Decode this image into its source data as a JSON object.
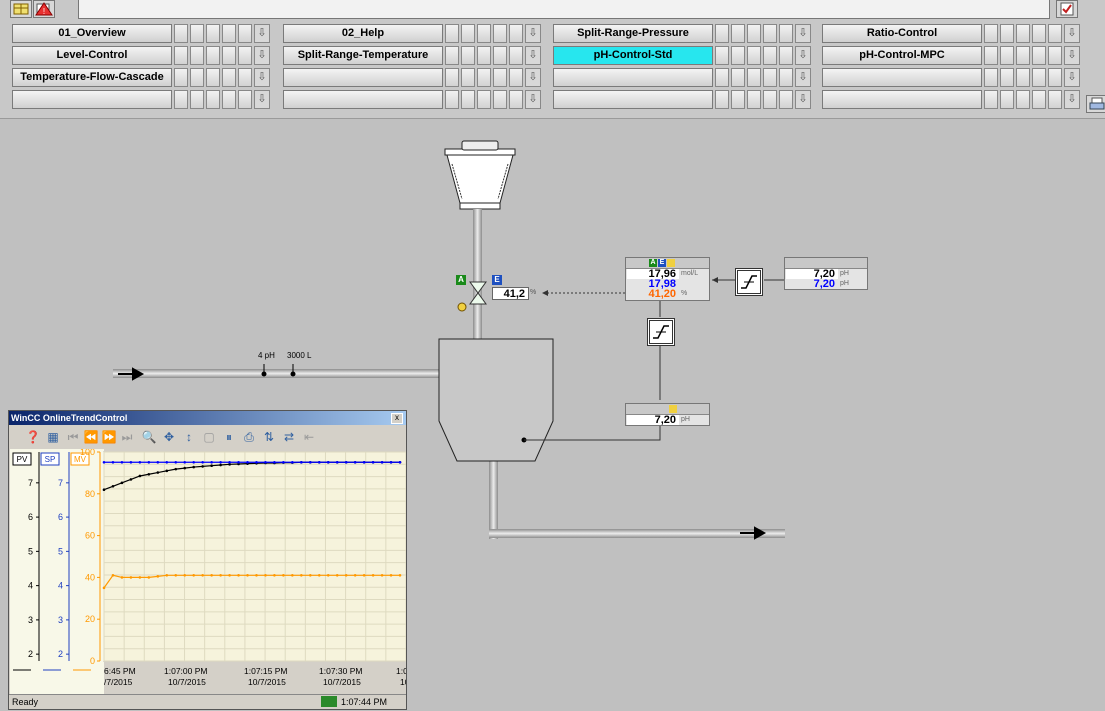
{
  "nav": {
    "rows": [
      [
        "01_Overview",
        "02_Help",
        "Split-Range-Pressure",
        "Ratio-Control"
      ],
      [
        "Level-Control",
        "Split-Range-Temperature",
        "pH-Control-Std",
        "pH-Control-MPC"
      ],
      [
        "Temperature-Flow-Cascade",
        "",
        "",
        ""
      ],
      [
        "",
        "",
        "",
        ""
      ]
    ],
    "active": "pH-Control-Std",
    "arrow_glyph": "⇩"
  },
  "process": {
    "valve": {
      "auto_badge": "A",
      "ext_badge": "E",
      "output": "41,2",
      "output_unit": "%"
    },
    "inlet_tags": {
      "ph": "4 pH",
      "volume": "3000 L"
    },
    "controller": {
      "badges": [
        "A",
        "E"
      ],
      "pv": "17,96",
      "pv_unit": "mol/L",
      "sp": "17,98",
      "out": "41,20",
      "out_unit": "%"
    },
    "ph_setpoint": {
      "value": "7,20",
      "unit": "pH",
      "value2": "7,20",
      "unit2": "pH"
    },
    "ph_measure": {
      "value": "7,20",
      "unit": "pH"
    },
    "colors": {
      "pv": "#000000",
      "sp": "#0000ff",
      "out": "#ff6600",
      "active_nav": "#27e6ee"
    }
  },
  "trend": {
    "title": "WinCC OnlineTrendControl",
    "close_glyph": "x",
    "axis_buttons": [
      "PV",
      "SP",
      "MV"
    ],
    "pv_ticks": [
      "7",
      "6",
      "5",
      "4",
      "3",
      "2"
    ],
    "sp_ticks": [
      "7",
      "6",
      "5",
      "4",
      "3",
      "2"
    ],
    "mv_ticks": [
      "100",
      "80",
      "60",
      "40",
      "20",
      "0"
    ],
    "time_labels": [
      {
        "time": "6:45 PM",
        "date": "/7/2015"
      },
      {
        "time": "1:07:00 PM",
        "date": "10/7/2015"
      },
      {
        "time": "1:07:15 PM",
        "date": "10/7/2015"
      },
      {
        "time": "1:07:30 PM",
        "date": "10/7/2015"
      },
      {
        "time": "1:0",
        "date": "10"
      }
    ],
    "status_text": "Ready",
    "status_time": "1:07:44 PM"
  },
  "chart_data": {
    "type": "line",
    "series": [
      {
        "name": "PV",
        "color": "#000000",
        "values": [
          6.8,
          6.9,
          7.0,
          7.1,
          7.2,
          7.25,
          7.3,
          7.35,
          7.4,
          7.43,
          7.46,
          7.48,
          7.5,
          7.52,
          7.54,
          7.55,
          7.56,
          7.57,
          7.58,
          7.58,
          7.59,
          7.59,
          7.6,
          7.6,
          7.6,
          7.6,
          7.6,
          7.6,
          7.6,
          7.6,
          7.6,
          7.6,
          7.6,
          7.6
        ]
      },
      {
        "name": "SP",
        "color": "#0000ff",
        "values": [
          7.6,
          7.6,
          7.6,
          7.6,
          7.6,
          7.6,
          7.6,
          7.6,
          7.6,
          7.6,
          7.6,
          7.6,
          7.6,
          7.6,
          7.6,
          7.6,
          7.6,
          7.6,
          7.6,
          7.6,
          7.6,
          7.6,
          7.6,
          7.6,
          7.6,
          7.6,
          7.6,
          7.6,
          7.6,
          7.6,
          7.6,
          7.6,
          7.6,
          7.6
        ]
      },
      {
        "name": "MV",
        "color": "#ff9900",
        "axis": "mv",
        "values": [
          35,
          41,
          40,
          40,
          40,
          40,
          40.5,
          41,
          41,
          41,
          41,
          41,
          41,
          41,
          41,
          41,
          41,
          41,
          41,
          41,
          41,
          41,
          41,
          41,
          41,
          41,
          41,
          41,
          41,
          41,
          41,
          41,
          41,
          41
        ]
      }
    ],
    "ylim_ph": [
      1.8,
      7.9
    ],
    "ylim_mv": [
      0,
      100
    ]
  }
}
